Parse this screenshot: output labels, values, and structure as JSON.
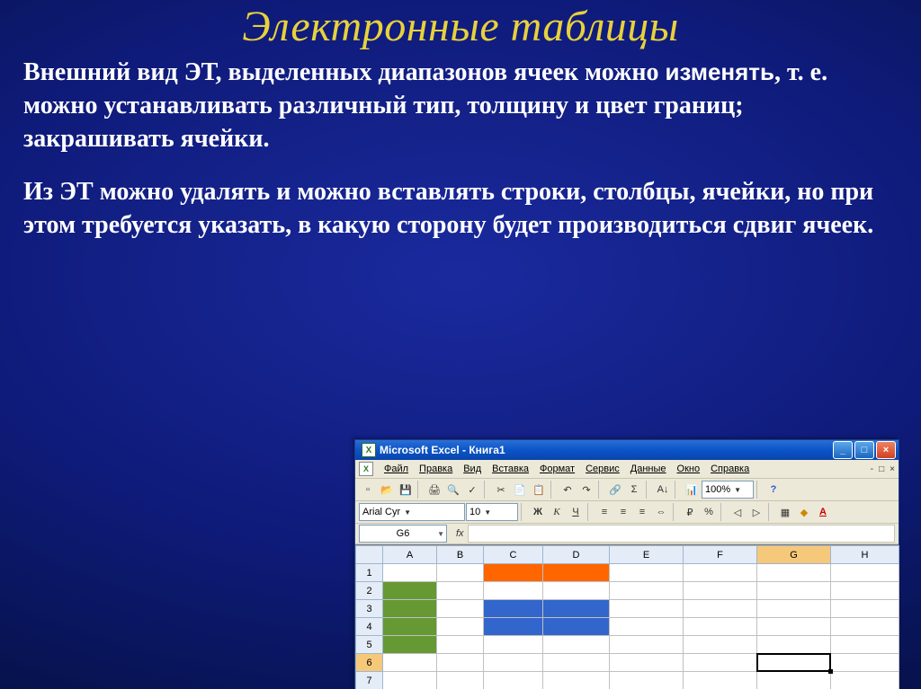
{
  "slide": {
    "title": "Электронные таблицы",
    "paragraph1_a": "Внешний вид ЭТ, выделенных диапазонов ячеек можно ",
    "paragraph1_emph": "изменять",
    "paragraph1_b": ", т. е. можно устанавливать различный тип, толщину и цвет границ; закрашивать ячейки.",
    "paragraph2": "Из ЭТ можно удалять и можно вставлять строки, столбцы, ячейки, но при этом требуется указать, в какую сторону будет производиться сдвиг ячеек."
  },
  "excel": {
    "window_title": "Microsoft Excel - Книга1",
    "menu": {
      "file": "Файл",
      "edit": "Правка",
      "view": "Вид",
      "insert": "Вставка",
      "format": "Формат",
      "tools": "Сервис",
      "data": "Данные",
      "window": "Окно",
      "help": "Справка"
    },
    "toolbar": {
      "font_name": "Arial Cyr",
      "font_size": "10",
      "zoom": "100%",
      "bold": "Ж",
      "italic": "К",
      "underline": "Ч"
    },
    "formula": {
      "namebox": "G6",
      "fx_label": "fx"
    },
    "grid": {
      "columns": [
        "A",
        "B",
        "C",
        "D",
        "E",
        "F",
        "G",
        "H"
      ],
      "rows": [
        "1",
        "2",
        "3",
        "4",
        "5",
        "6",
        "7"
      ],
      "active_cell": "G6",
      "selected_col": "G",
      "selected_row": "6",
      "fills": {
        "orange": [
          "C1",
          "D1"
        ],
        "green": [
          "A2",
          "A3",
          "A4",
          "A5"
        ],
        "blue": [
          "C3",
          "D3",
          "C4",
          "D4"
        ]
      }
    }
  }
}
